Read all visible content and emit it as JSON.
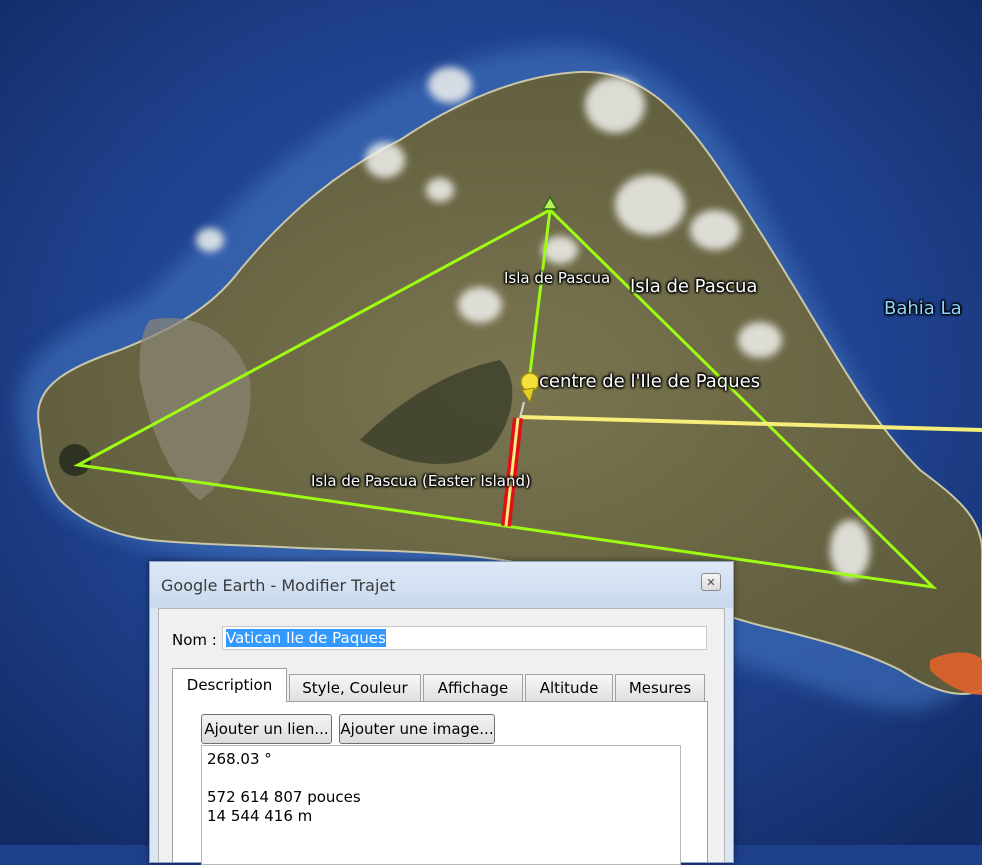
{
  "map": {
    "labels": {
      "island_name_small": "Isla de Pascua",
      "island_name_large": "Isla de Pascua",
      "island_full": "Isla de Pascua (Easter Island)",
      "placemark": "centre de l'Ile de Paques",
      "bay": "Bahia La"
    },
    "colors": {
      "ocean": "#1e3f8a",
      "land": "#6e6a45",
      "triangle": "#9efc12",
      "path_red": "#e0101a",
      "path_yellow": "#f7ee7a"
    }
  },
  "dialog": {
    "title": "Google Earth - Modifier Trajet",
    "close_glyph": "✕",
    "name_label": "Nom :",
    "name_value": "Vatican Ile de Paques",
    "tabs": [
      {
        "label": "Description",
        "active": true
      },
      {
        "label": "Style, Couleur",
        "active": false
      },
      {
        "label": "Affichage",
        "active": false
      },
      {
        "label": "Altitude",
        "active": false
      },
      {
        "label": "Mesures",
        "active": false
      }
    ],
    "buttons": {
      "add_link": "Ajouter un lien...",
      "add_image": "Ajouter une image..."
    },
    "description_lines": [
      "268.03 °",
      "",
      "572 614 807 pouces",
      "14 544 416 m"
    ]
  }
}
